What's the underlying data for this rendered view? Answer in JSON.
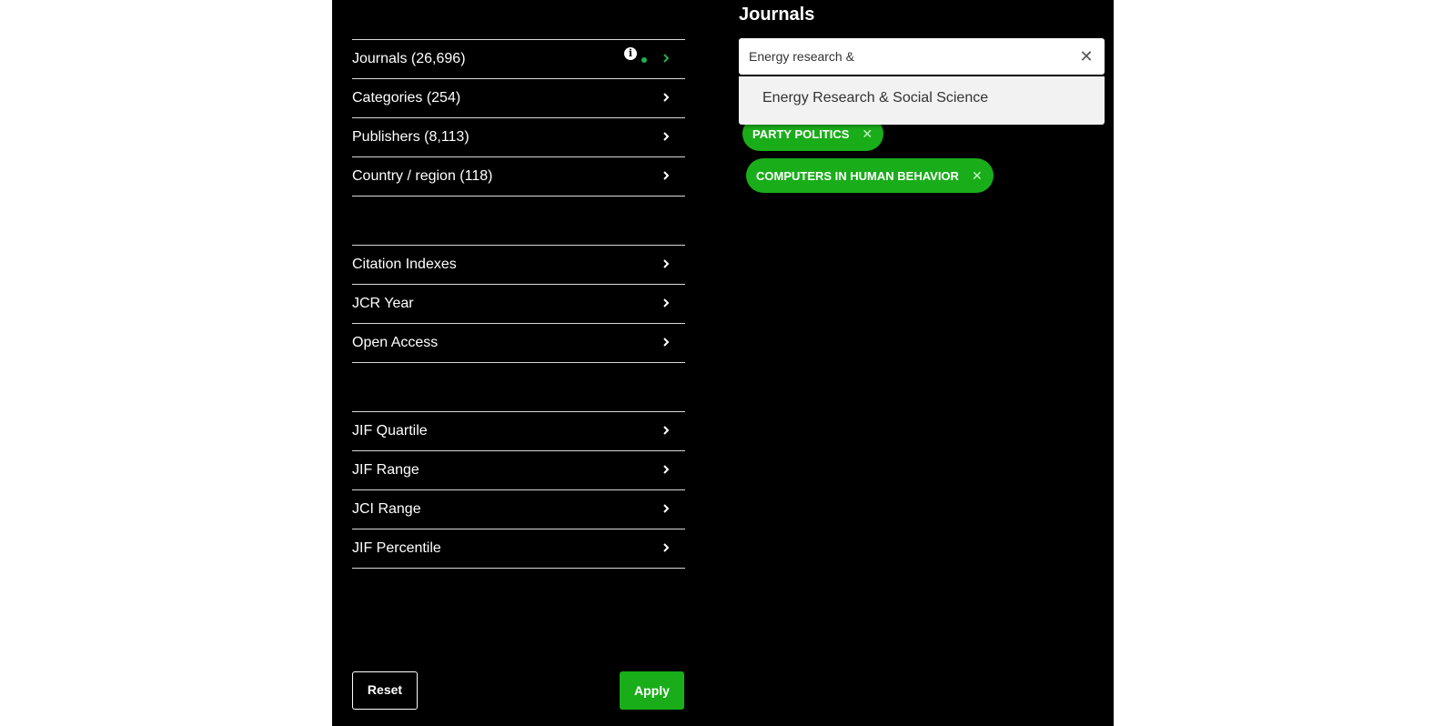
{
  "heading": "Journals",
  "search": {
    "value": "Energy research &",
    "clear_icon": "close-icon",
    "suggestions": [
      "Energy Research & Social Science"
    ]
  },
  "filter_groups": [
    {
      "items": [
        {
          "label": "Journals (26,696)",
          "active": true
        },
        {
          "label": "Categories (254)"
        },
        {
          "label": "Publishers (8,113)"
        },
        {
          "label": "Country / region (118)"
        }
      ]
    },
    {
      "items": [
        {
          "label": "Citation Indexes"
        },
        {
          "label": "JCR Year"
        },
        {
          "label": "Open Access"
        }
      ]
    },
    {
      "items": [
        {
          "label": "JIF Quartile"
        },
        {
          "label": "JIF Range"
        },
        {
          "label": "JCI Range"
        },
        {
          "label": "JIF Percentile"
        }
      ]
    }
  ],
  "selected_chips": [
    "PARTY POLITICS",
    "COMPUTERS IN HUMAN BEHAVIOR"
  ],
  "info_icon_glyph": "i",
  "chip_remove_glyph": "✕",
  "buttons": {
    "reset": "Reset",
    "apply": "Apply"
  },
  "colors": {
    "accent_green": "#1aad1a",
    "panel_bg": "#000000"
  }
}
